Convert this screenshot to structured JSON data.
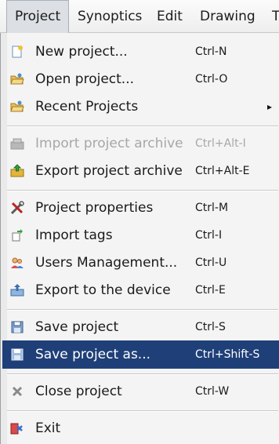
{
  "menubar": {
    "items": [
      {
        "label": "Project",
        "active": true
      },
      {
        "label": "Synoptics"
      },
      {
        "label": "Edit"
      },
      {
        "label": "Drawing"
      },
      {
        "label": "T"
      }
    ]
  },
  "menu": {
    "items": [
      {
        "label": "New project...",
        "shortcut": "Ctrl-N",
        "icon": "new-project-icon"
      },
      {
        "label": "Open project...",
        "shortcut": "Ctrl-O",
        "icon": "open-folder-icon"
      },
      {
        "label": "Recent Projects",
        "shortcut": "",
        "icon": "folder-icon",
        "submenu": true,
        "arrow": "▸"
      },
      {
        "label": "Import project archive",
        "shortcut": "Ctrl+Alt-I",
        "icon": "import-archive-icon",
        "disabled": true
      },
      {
        "label": "Export project archive",
        "shortcut": "Ctrl+Alt-E",
        "icon": "export-archive-icon"
      },
      {
        "label": "Project properties",
        "shortcut": "Ctrl-M",
        "icon": "properties-tools-icon"
      },
      {
        "label": "Import tags",
        "shortcut": "Ctrl-I",
        "icon": "import-tags-icon"
      },
      {
        "label": "Users Management...",
        "shortcut": "Ctrl-U",
        "icon": "users-icon"
      },
      {
        "label": "Export to the device",
        "shortcut": "Ctrl-E",
        "icon": "export-device-icon"
      },
      {
        "label": "Save project",
        "shortcut": "Ctrl-S",
        "icon": "save-icon"
      },
      {
        "label": "Save project as...",
        "shortcut": "Ctrl+Shift-S",
        "icon": "save-as-icon",
        "highlighted": true
      },
      {
        "label": "Close project",
        "shortcut": "Ctrl-W",
        "icon": "close-project-icon"
      },
      {
        "label": "Exit",
        "shortcut": "",
        "icon": "exit-icon"
      }
    ]
  },
  "colors": {
    "highlight": "#1f3f78",
    "disabled_text": "#a7a7a7"
  }
}
